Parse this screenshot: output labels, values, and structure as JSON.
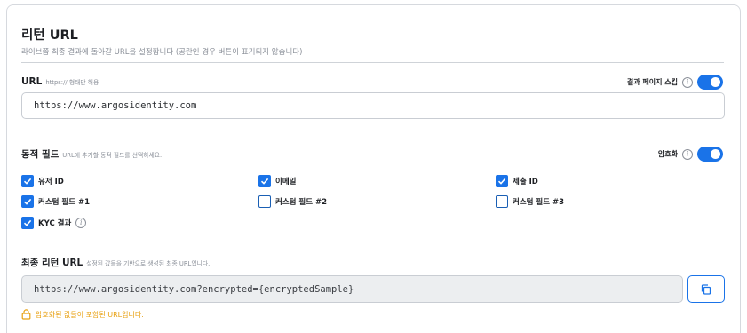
{
  "section": {
    "title": "리턴 URL",
    "description": "라이브쯤 최종 결과에 돌아갈 URL을 설정합니다 (공란인 경우 버튼이 표기되지 않습니다)"
  },
  "url_field": {
    "label": "URL",
    "hint": "https:// 형태만 허용",
    "value": "https://www.argosidentity.com",
    "skip_toggle_label": "결과 페이지 스킵",
    "skip_toggle_on": true
  },
  "dynamic_fields": {
    "label": "동적 필드",
    "hint": "URL에 추가할 동적 필드를 선택하세요.",
    "encrypt_toggle_label": "암호화",
    "encrypt_toggle_on": true,
    "options": [
      {
        "label": "유저 ID",
        "checked": true
      },
      {
        "label": "이메일",
        "checked": true
      },
      {
        "label": "제출 ID",
        "checked": true
      },
      {
        "label": "커스텀 필드 #1",
        "checked": true
      },
      {
        "label": "커스텀 필드 #2",
        "checked": false
      },
      {
        "label": "커스텀 필드 #3",
        "checked": false
      },
      {
        "label": "KYC 결과",
        "checked": true
      }
    ]
  },
  "final_url": {
    "label": "최종 리턴 URL",
    "hint": "설정된 값들을 기반으로 생성된 최종 URL입니다.",
    "value": "https://www.argosidentity.com?encrypted={encryptedSample}",
    "note": "암호화된 값들이 포함된 URL입니다."
  },
  "colors": {
    "accent": "#1a73e8",
    "warning": "#e8a010"
  },
  "icons": {
    "info": "info-icon",
    "checkmark": "check-icon",
    "copy": "copy-icon",
    "lock": "lock-icon"
  }
}
